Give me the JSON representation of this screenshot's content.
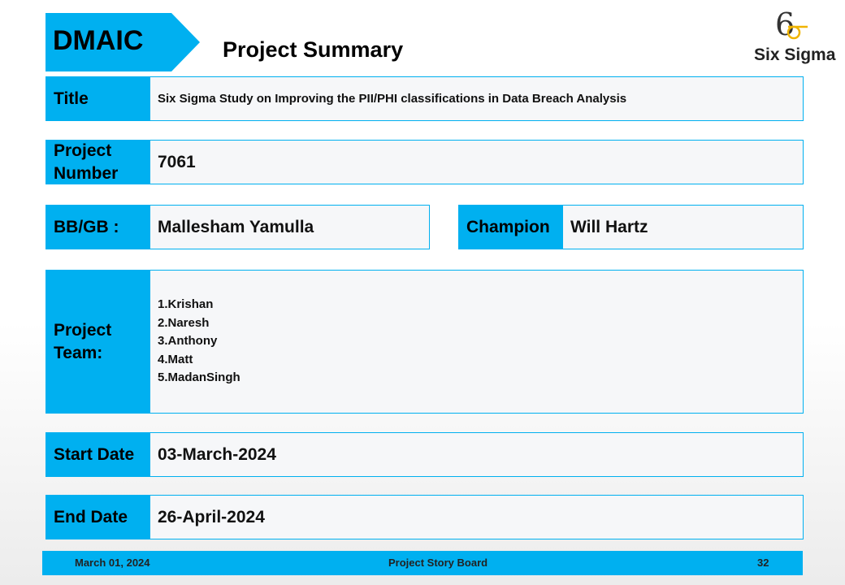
{
  "header": {
    "tag": "DMAIC",
    "title": "Project Summary",
    "logo_text": "Six Sigma",
    "logo_numeral": "6"
  },
  "fields": {
    "title": {
      "label": "Title",
      "value": "Six Sigma Study on Improving the PII/PHI classifications in Data Breach Analysis"
    },
    "project_number": {
      "label": "Project Number",
      "value": "7061"
    },
    "bb_gb": {
      "label": "BB/GB :",
      "value": "Mallesham Yamulla"
    },
    "champion": {
      "label": "Champion",
      "value": "Will Hartz"
    },
    "project_team": {
      "label": "Project Team:",
      "members": [
        "1.Krishan",
        "2.Naresh",
        "3.Anthony",
        "4.Matt",
        "5.MadanSingh"
      ]
    },
    "start_date": {
      "label": "Start Date",
      "value": "03-March-2024"
    },
    "end_date": {
      "label": "End Date",
      "value": "26-April-2024"
    }
  },
  "footer": {
    "date": "March 01, 2024",
    "center": "Project Story Board",
    "page": "32"
  },
  "colors": {
    "accent": "#00b0f0",
    "logo_gold": "#f0b400"
  }
}
